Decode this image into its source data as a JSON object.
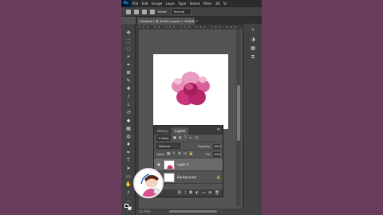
{
  "app": {
    "logo": "Ps",
    "menus": [
      "File",
      "Edit",
      "Image",
      "Layer",
      "Type",
      "Select",
      "Filter",
      "3D",
      "Vi"
    ]
  },
  "options_bar": {
    "mode_label": "Mode:",
    "mode_value": "Normal"
  },
  "document_tab": {
    "title": "Untitled-1 @ 22.8% (Layer 1, RGB/8) *"
  },
  "ruler": {
    "ticks": "200 50 100 150 200 250 300"
  },
  "status": {
    "zoom": "22.79%"
  },
  "layers_panel": {
    "tabs": [
      "History",
      "Layers"
    ],
    "active_tab": "Layers",
    "filter_label": "Kind",
    "blend_mode": "Normal",
    "opacity_label": "Opacity:",
    "opacity_value": "100%",
    "lock_label": "Lock:",
    "fill_label": "Fill:",
    "fill_value": "100%",
    "layers": [
      {
        "name": "Layer 1",
        "selected": true
      },
      {
        "name": "Background",
        "selected": false
      }
    ]
  },
  "colors": {
    "outside_bg": "#6b3d5c",
    "ps_bg": "#535353",
    "flower": "#c8337a"
  }
}
